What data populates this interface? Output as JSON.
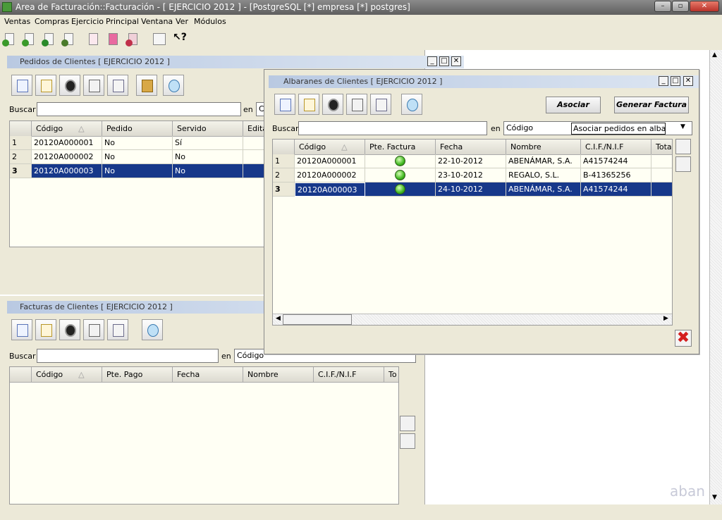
{
  "window": {
    "title": "Area de Facturación::Facturación  - [ EJERCICIO 2012 ] - [PostgreSQL [*] empresa [*] postgres]",
    "minimize": "–",
    "restore": "▫",
    "close": "✕"
  },
  "menu": [
    "Ventas",
    "Compras",
    "Ejercicio",
    "Principal",
    "Ventana",
    "Ver",
    "Módulos"
  ],
  "toolbar_icons": [
    "clients-icon",
    "pedidos-icon",
    "albaranes-icon",
    "facturas-icon",
    "document-icon",
    "document-pink-icon",
    "document-red-icon",
    "calendar-icon",
    "whats-this-icon"
  ],
  "pedidos": {
    "title": "Pedidos de Clientes [ EJERCICIO 2012 ]",
    "search_label": "Buscar",
    "en_label": "en",
    "combo_value": "C",
    "headers": [
      "Código",
      "Pedido",
      "Servido",
      "Edita"
    ],
    "rows": [
      {
        "n": "1",
        "codigo": "20120A000001",
        "pedido": "No",
        "servido": "Sí"
      },
      {
        "n": "2",
        "codigo": "20120A000002",
        "pedido": "No",
        "servido": "No"
      },
      {
        "n": "3",
        "codigo": "20120A000003",
        "pedido": "No",
        "servido": "No"
      }
    ]
  },
  "facturas": {
    "title": "Facturas de Clientes [ EJERCICIO 2012 ]",
    "search_label": "Buscar",
    "en_label": "en",
    "combo_value": "Código",
    "headers": [
      "Código",
      "Pte. Pago",
      "Fecha",
      "Nombre",
      "C.I.F./N.I.F",
      "To"
    ]
  },
  "albaranes": {
    "title": "Albaranes de Clientes [ EJERCICIO 2012 ]",
    "asociar_label": "Asociar",
    "generar_label": "Generar Factura",
    "search_label": "Buscar",
    "en_label": "en",
    "combo_value": "Código",
    "filter_value": "Asociar pedidos en albaran",
    "headers": [
      "Código",
      "Pte. Factura",
      "Fecha",
      "Nombre",
      "C.I.F./N.I.F",
      "Total"
    ],
    "rows": [
      {
        "n": "1",
        "codigo": "20120A000001",
        "fecha": "22-10-2012",
        "nombre": "ABENÁMAR, S.A.",
        "cif": "A41574244"
      },
      {
        "n": "2",
        "codigo": "20120A000002",
        "fecha": "23-10-2012",
        "nombre": "REGALO, S.L.",
        "cif": "B-41365256"
      },
      {
        "n": "3",
        "codigo": "20120A000003",
        "fecha": "24-10-2012",
        "nombre": "ABENÁMAR, S.A.",
        "cif": "A41574244"
      }
    ],
    "close_glyph": "✖"
  },
  "watermark": "aban",
  "colors": {
    "selection": "#17388a",
    "status_green": "#40b820",
    "close_red": "#d41e1e"
  }
}
